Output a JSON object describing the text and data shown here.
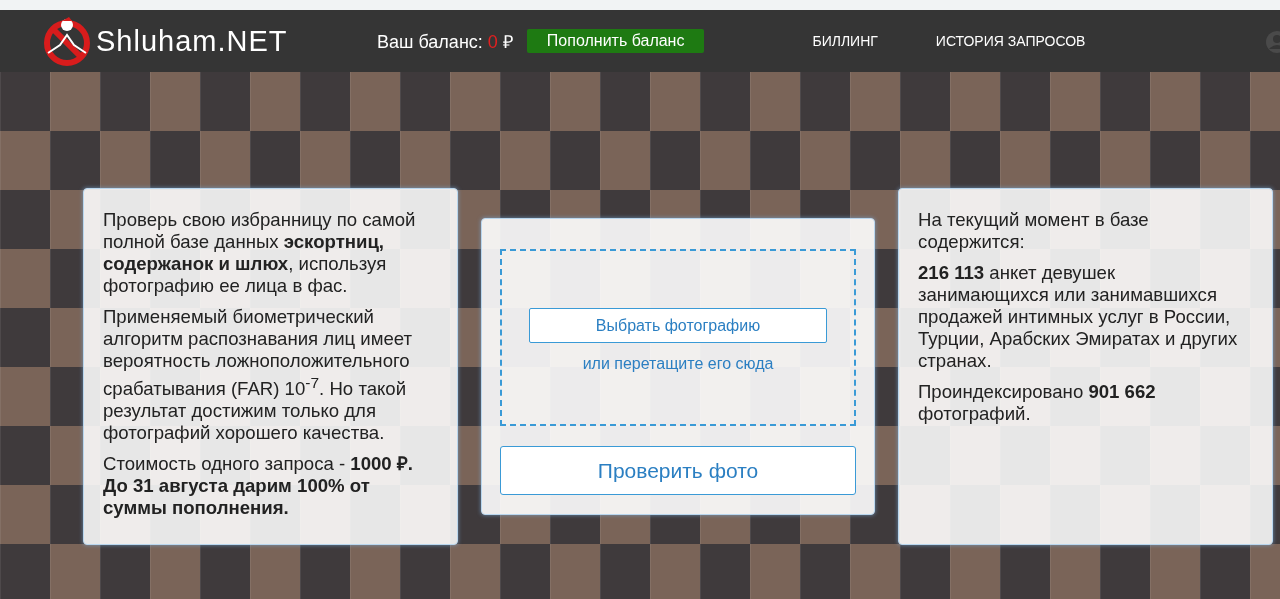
{
  "header": {
    "logo_text": "Shluham.NET",
    "balance_label": "Ваш баланс:",
    "balance_value": "0",
    "currency": "₽",
    "top_up_button": "Пополнить баланс",
    "nav": [
      {
        "label": "БИЛЛИНГ"
      },
      {
        "label": "ИСТОРИЯ ЗАПРОСОВ"
      }
    ]
  },
  "left_card": {
    "paragraphs": [
      "Проверь свою избранницу по самой полной базе данных **эскортниц, содержанок и шлюх**, используя фотографию ее лица в фас.",
      "Применяемый биометрический алгоритм распознавания лиц имеет вероятность ложноположительного срабатывания (FAR) 10$^{-7}$. Но такой результат достижим только для фотографий хорошего качества.",
      "Стоимость одного запроса - **1000 ₽. До 31 августа дарим 100% от суммы пополнения.**"
    ]
  },
  "upload": {
    "choose_button": "Выбрать фотографию",
    "drop_hint": "или перетащите его сюда",
    "check_button": "Проверить фото"
  },
  "right_card": {
    "paragraphs": [
      "На текущий момент в базе содержится:",
      "**216 113** анкет девушек занимающихся или занимавшихся продажей интимных услуг в России, Турции, Арабских Эмиратах и других странах.",
      "Проиндексировано **901 662** фотографий."
    ]
  }
}
